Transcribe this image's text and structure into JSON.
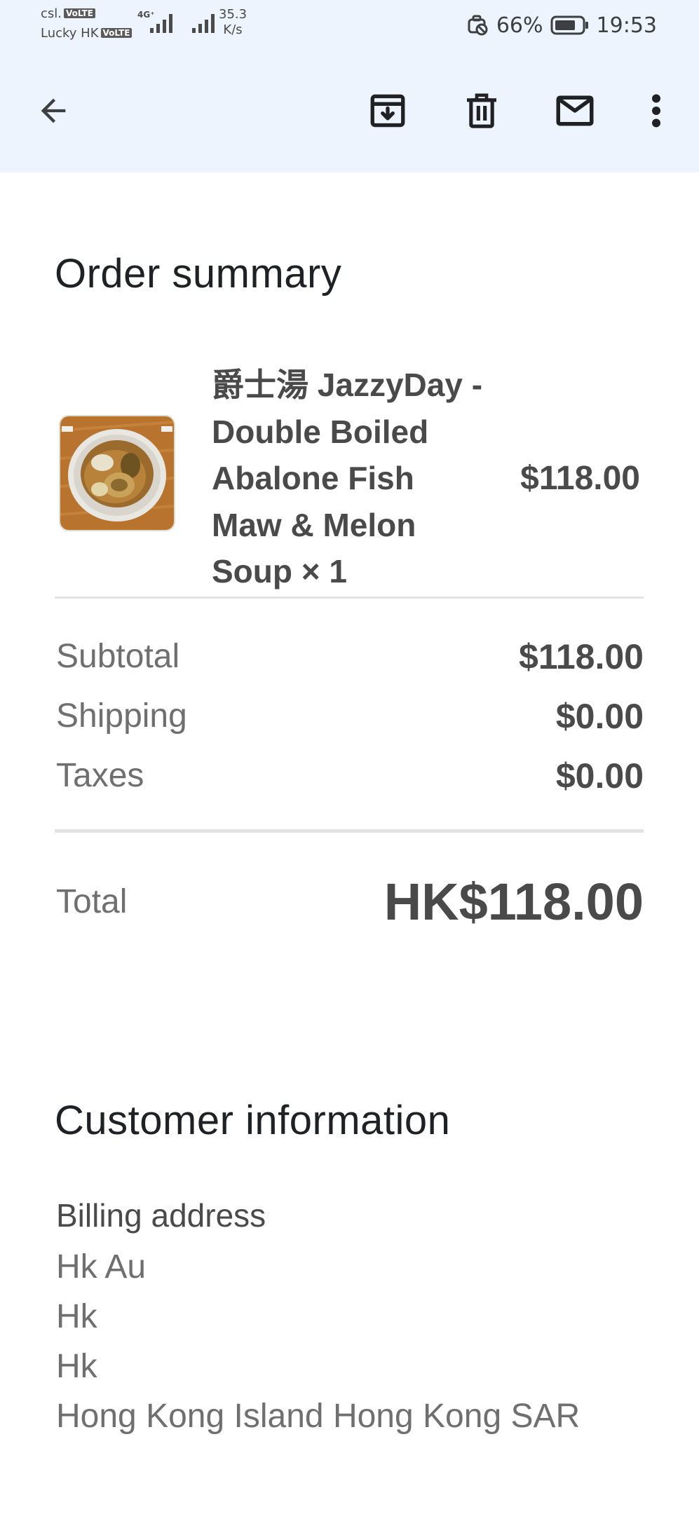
{
  "status_bar": {
    "carrier_1": "csl.",
    "carrier_2": "Lucky HK",
    "volte_1": "VoLTE",
    "volte_2": "VoLTE",
    "network_type": "4G⁺",
    "speed_value": "35.3",
    "speed_unit": "K/s",
    "battery_percent": "66%",
    "time": "19:53",
    "icons": [
      "vibrate-off-icon",
      "battery-icon",
      "signal-icon"
    ]
  },
  "toolbar": {
    "icons": [
      "back-arrow-icon",
      "archive-icon",
      "delete-icon",
      "mark-unread-icon",
      "more-vert-icon"
    ]
  },
  "order_summary": {
    "title": "Order summary",
    "item": {
      "name": "爵士湯 JazzyDay - Double Boiled Abalone Fish Maw & Melon Soup × 1",
      "price": "$118.00",
      "image": "abalone-soup-photo"
    },
    "subtotal_label": "Subtotal",
    "subtotal_value": "$118.00",
    "shipping_label": "Shipping",
    "shipping_value": "$0.00",
    "taxes_label": "Taxes",
    "taxes_value": "$0.00",
    "total_label": "Total",
    "total_value": "HK$118.00"
  },
  "customer_information": {
    "title": "Customer information",
    "billing_heading": "Billing address",
    "billing_lines": [
      "Hk Au",
      "Hk",
      "Hk",
      "Hong Kong Island Hong Kong SAR"
    ]
  },
  "colors": {
    "header_background": "#edf4fd",
    "text_dark": "#202124",
    "text_strong": "#4a4a4a",
    "text_muted": "#6f6f6f",
    "divider": "#e3e3e3"
  }
}
